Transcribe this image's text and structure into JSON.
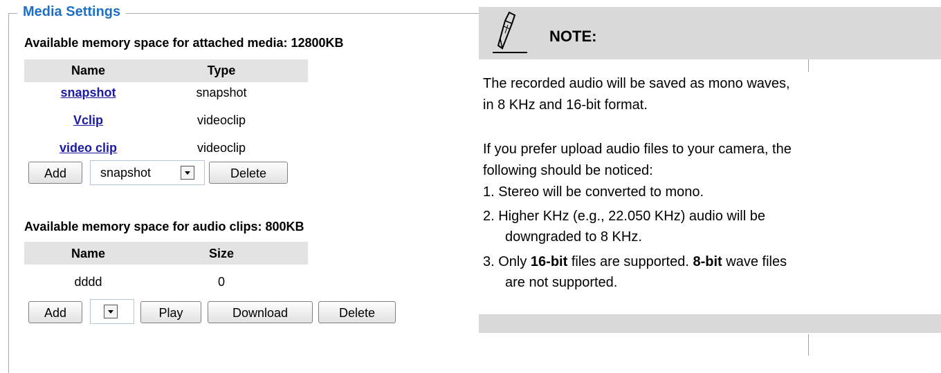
{
  "media_settings": {
    "legend": "Media Settings",
    "media_memory": "Available memory space for attached media: 12800KB",
    "media_headers": [
      "Name",
      "Type"
    ],
    "media_rows": [
      {
        "name": "snapshot",
        "type": "snapshot"
      },
      {
        "name": "Vclip",
        "type": "videoclip"
      },
      {
        "name": "video clip",
        "type": "videoclip"
      }
    ],
    "media_controls": {
      "add": "Add",
      "select_value": "snapshot",
      "delete": "Delete"
    },
    "audio_memory": "Available memory space for audio clips: 800KB",
    "audio_headers": [
      "Name",
      "Size"
    ],
    "audio_rows": [
      {
        "name": "dddd",
        "size": "0"
      }
    ],
    "audio_controls": {
      "add": "Add",
      "select_value": "",
      "play": "Play",
      "download": "Download",
      "delete": "Delete"
    }
  },
  "note": {
    "title": "NOTE:",
    "p1_line1": "The recorded audio will be saved as mono waves,",
    "p1_line2": "in 8 KHz and 16-bit format.",
    "p2_line1": "If you prefer upload audio files to your camera, the",
    "p2_line2": "following should be noticed:",
    "item1": "1. Stereo will be converted to mono.",
    "item2_line1": "2. Higher KHz (e.g., 22.050 KHz) audio will be",
    "item2_line2": "downgraded to 8 KHz.",
    "item3_prefix": "3. Only ",
    "item3_bold1": "16-bit",
    "item3_mid": " files are supported. ",
    "item3_bold2": "8-bit",
    "item3_suffix": " wave files",
    "item3_line2": "are not supported."
  },
  "icons": {
    "note_icon": "pencil-icon",
    "dropdown": "chevron-down-icon"
  }
}
